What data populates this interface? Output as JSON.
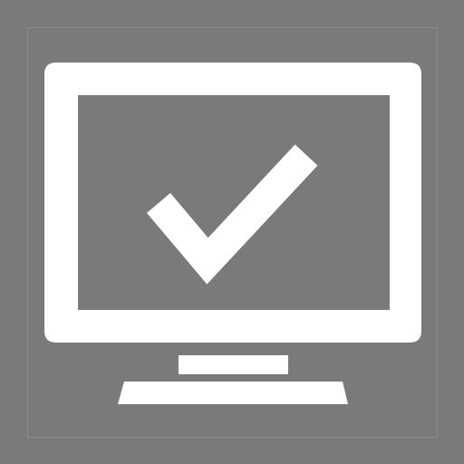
{
  "icon": {
    "name": "monitor-check-icon",
    "background_color": "#7a7a7a",
    "foreground_color": "#ffffff",
    "frame_color": "#8c8c8c"
  }
}
